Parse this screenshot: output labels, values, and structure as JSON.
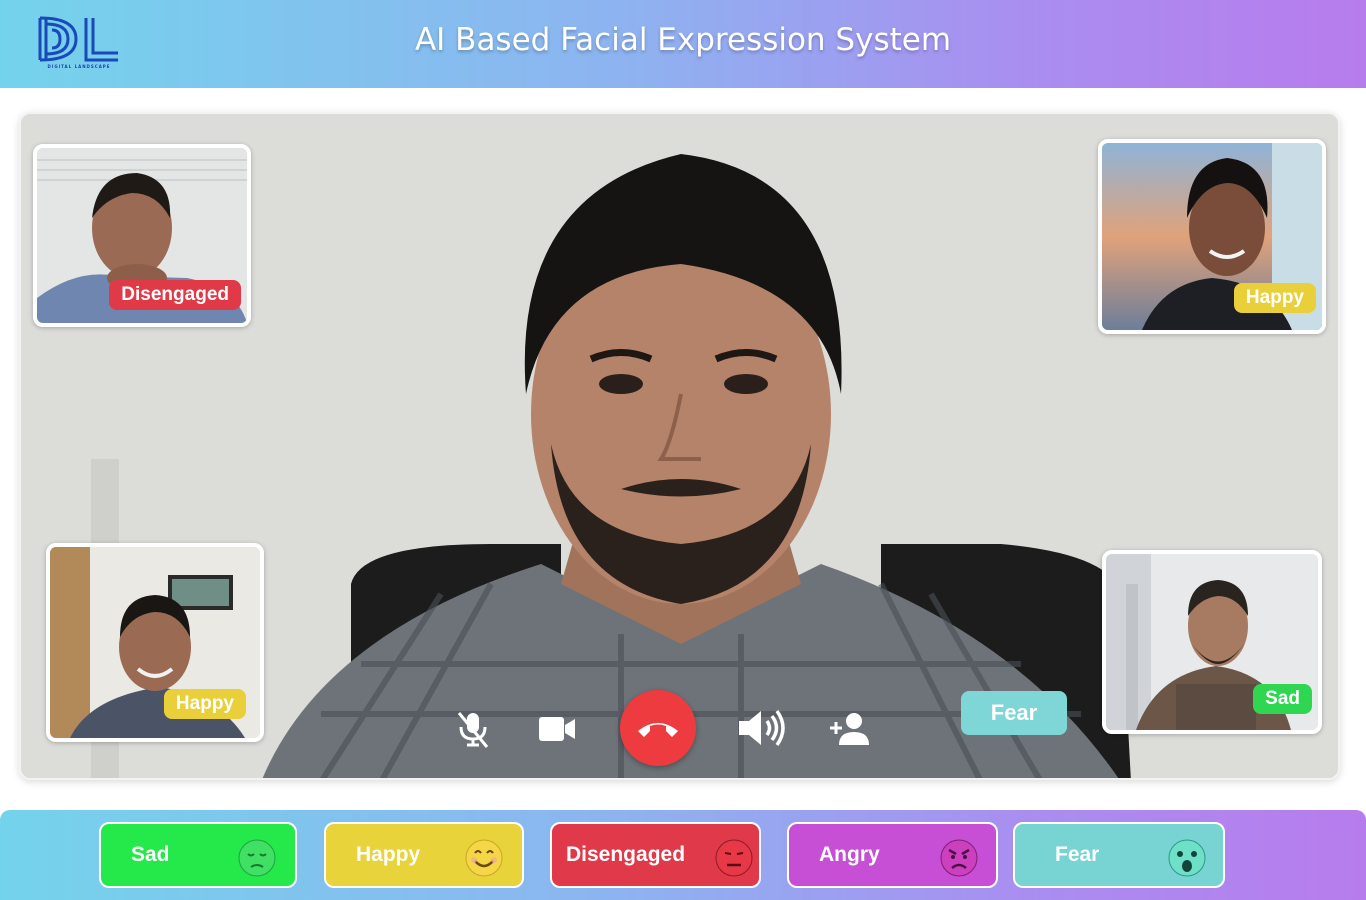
{
  "header": {
    "title": "AI Based Facial Expression System",
    "logo_text": "DIGITAL LANDSCAPE"
  },
  "participants": [
    {
      "label": "Disengaged",
      "color": "#e03a49"
    },
    {
      "label": "Happy",
      "color": "#e9cf3a"
    },
    {
      "label": "Happy",
      "color": "#e9cf3a"
    },
    {
      "label": "Sad",
      "color": "#2fd651"
    }
  ],
  "main_video": {
    "label": "Fear",
    "color": "#7fd6d6"
  },
  "controls": {
    "mic": "mic-off-icon",
    "camera": "video-camera-icon",
    "hangup": "phone-hangup-icon",
    "volume": "volume-up-icon",
    "add_user": "add-user-icon"
  },
  "emotions": [
    {
      "label": "Sad",
      "color": "#25e84a",
      "icon": "sad-face-icon"
    },
    {
      "label": "Happy",
      "color": "#e8d33b",
      "icon": "smiling-face-icon"
    },
    {
      "label": "Disengaged",
      "color": "#e0394a",
      "icon": "neutral-face-icon"
    },
    {
      "label": "Angry",
      "color": "#c64fd6",
      "icon": "angry-face-icon"
    },
    {
      "label": "Fear",
      "color": "#78d3d3",
      "icon": "fearful-face-icon"
    }
  ]
}
